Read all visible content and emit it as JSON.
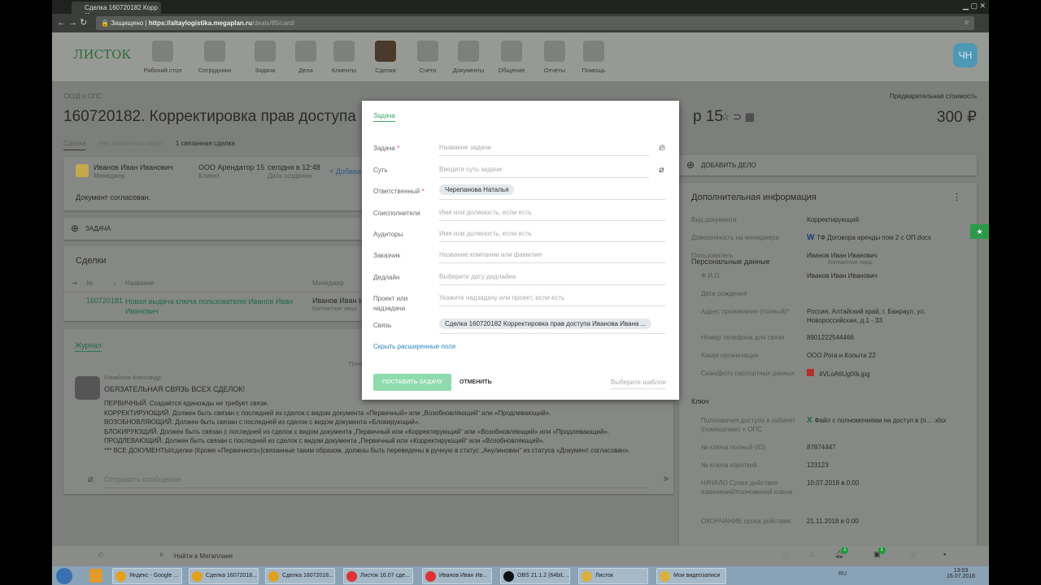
{
  "browser": {
    "tab_title": "Сделка 160720182 Корр",
    "secure_label": "Защищено",
    "url_host": "https://altaylogistika.megaplan.ru",
    "url_path": "/deals/85/card/"
  },
  "nav": {
    "logo": "ЛИСТОК",
    "items": [
      "Рабочий стол",
      "Сотрудники",
      "Задачи",
      "Дела",
      "Клиенты",
      "Сделки",
      "Счета",
      "Документы",
      "Общение",
      "Отчёты",
      "Помощь"
    ],
    "avatar": "ЧН"
  },
  "deal": {
    "breadcrumb": "СКУД и ОПС",
    "title": "160720182. Корректировка прав доступа",
    "title_tail": "р 15",
    "price_label": "Предварительная стоимость",
    "price": "300 ₽",
    "tabs": [
      "Сделка",
      "Нет связанных задач",
      "1 связанная сделка"
    ],
    "manager_name": "Иванов Иван Иванович",
    "manager_role": "Менеджер",
    "client_name": "ООО Арендатор 15",
    "client_role": "Клиент",
    "created": "сегодня в 12:48",
    "created_label": "Дата создания",
    "add_link": "+ Добави",
    "status": "Документ согласован.",
    "add_task": "ЗАДАЧА",
    "add_deal": "ДОБАВИТЬ ДЕЛО"
  },
  "deals_table": {
    "title": "Сделки",
    "headers": [
      "№",
      "Название",
      "Менеджер"
    ],
    "rows": [
      {
        "num": "160720181",
        "name": "Новая выдача ключа пользователю Иванов Иван Иванович",
        "manager": "Иванов Иван И",
        "manager_role": "Контактное лицо"
      }
    ]
  },
  "journal": {
    "tab": "Журнал",
    "date": "Понеде",
    "author": "Измайлов Александр",
    "heading": "ОБЯЗАТЕЛЬНАЯ СВЯЗЬ ВСЕХ СДЕЛОК!",
    "lines": [
      "ПЕРВИЧНЫЙ. Создаётся единожды не требует связи.",
      "КОРРЕКТИРУЮЩИЙ. Должен быть связан с последней из сделок с видом документа «Первичный» или „Возобновляющий“ или «Продлевающий».",
      "ВОЗОБНОВЛЯЮЩИЙ. Должен быть связан с последней из сделок с видом документа «Блокирующий».",
      "БЛОКИРУЮЩИЙ. Должен быть связан с последней из сделок с видом документа „Первичный или «Корректирующий“ или «Возобновляющий» или «Продлевающий».",
      "ПРОДЛЕВАЮЩИЙ. Должен быть связан с последней из сделок с видом документа „Первичный или «Корректирующий“ или «Возобновляющий».",
      "*** ВСЕ ДОКУМЕНТЫ/сделки (Кроме «Первичного»)связанные таким образом, должны быть переведены в ручную в статус „Анулинован“ из статуса «Документ согласован»."
    ],
    "message_placeholder": "Отправить сообщение"
  },
  "info": {
    "title": "Дополнительная информация",
    "rows": [
      {
        "label": "Вид документа",
        "value": "Корректирующий"
      },
      {
        "label": "Доверенность на менеджера",
        "value": "ТФ Договора аренды пом 2 с ОП.docx"
      },
      {
        "label": "Пользователь",
        "value": "Иванов Иван Иванович",
        "sub": "Контактное лицо"
      }
    ],
    "personal_title": "Персональные данные",
    "personal": [
      {
        "label": "Ф.И.О.",
        "value": "Иванов Иван Иванович"
      },
      {
        "label": "Дата рождения",
        "value": ""
      },
      {
        "label": "Адрес проживания (полный)*",
        "value": "Россия, Алтайский край, г. Банраул, ул. Новороссийская, д.1 - 33"
      },
      {
        "label": "Номер телефона для связи",
        "value": "8901222544466"
      },
      {
        "label": "Какая организация",
        "value": "ООО Рога и Копыта 22"
      },
      {
        "label": "Скан/фото паспортных данных",
        "value": "4VLoA6UglXk.jpg"
      }
    ],
    "key_title": "Ключ",
    "key": [
      {
        "label": "Полномочия доступа в кабинет (помещение) + ОПС",
        "value": "Файл с полномочиями на доступ в (п... .xlsx"
      },
      {
        "label": "№ ключа полный (ID)",
        "value": "87874447"
      },
      {
        "label": "№ ключа короткий",
        "value": "123123"
      },
      {
        "label": "НАЧАЛО Срока действия изменений/полномочий ключа",
        "value": "10.07.2018 в 0:00"
      },
      {
        "label": "ОКОНЧАНИЕ срока действия",
        "value": "21.11.2018 в 0:00"
      }
    ]
  },
  "modal": {
    "tab": "Задача",
    "fields": [
      {
        "label": "Задача",
        "required": "*",
        "placeholder": "Название задачи"
      },
      {
        "label": "Суть",
        "placeholder": "Введите суть задачи"
      },
      {
        "label": "Ответственный",
        "required": "*",
        "chip": "Черепанова Наталья"
      },
      {
        "label": "Соисполнители",
        "placeholder": "Имя или должность, если есть"
      },
      {
        "label": "Аудиторы",
        "placeholder": "Имя или должность, если есть"
      },
      {
        "label": "Заказчик",
        "placeholder": "Название компании или фамилия"
      },
      {
        "label": "Дедлайн",
        "placeholder": "Выберите дату дедлайна"
      },
      {
        "label": "Проект или надзадача",
        "placeholder": "Укажите надзадачу или проект, если есть"
      },
      {
        "label": "Связь",
        "chip": "Сделка 160720182 Корректировка прав доступа Иванова Ивана ..."
      }
    ],
    "hide_link": "Скрыть расширенные поля",
    "submit": "ПОСТАВИТЬ ЗАДАЧУ",
    "cancel": "ОТМЕНИТЬ",
    "template": "Выберите шаблон"
  },
  "bottombar": {
    "search": "Найти в Мегаплане",
    "notif_count": "1",
    "chat_count": "1"
  },
  "taskbar": {
    "items": [
      "Яндекс - Google ...",
      "Сделка 16072018...",
      "Сделка 16072018...",
      "Листок 16.07 сде...",
      "Иванов Иван Ив...",
      "OBS 21.1.2 (64bit, ...",
      "Листок",
      "Мои видеозаписи"
    ],
    "lang": "RU",
    "time": "13:03",
    "date": "16.07.2018"
  },
  "colors": {
    "accent": "#3aa86b",
    "avatar": "#4d98b4"
  }
}
